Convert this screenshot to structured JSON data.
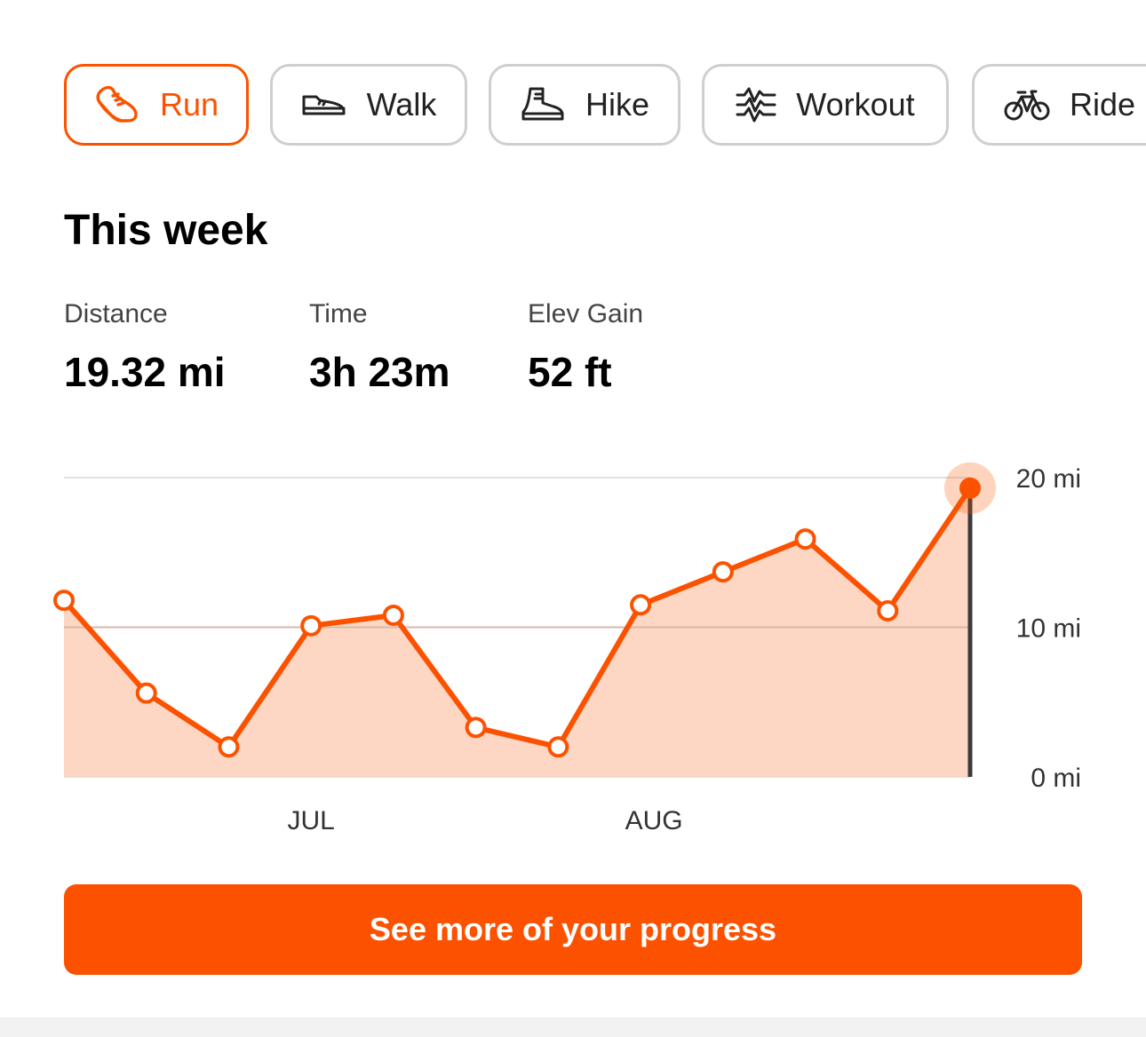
{
  "activity_tabs": [
    {
      "label": "Run",
      "icon": "shoe-run-icon",
      "active": true
    },
    {
      "label": "Walk",
      "icon": "shoe-walk-icon",
      "active": false
    },
    {
      "label": "Hike",
      "icon": "boot-hike-icon",
      "active": false
    },
    {
      "label": "Workout",
      "icon": "workout-wave-icon",
      "active": false
    },
    {
      "label": "Ride",
      "icon": "bicycle-icon",
      "active": false
    }
  ],
  "section_title": "This week",
  "stats": [
    {
      "label": "Distance",
      "value": "19.32 mi"
    },
    {
      "label": "Time",
      "value": "3h 23m"
    },
    {
      "label": "Elev Gain",
      "value": "52 ft"
    }
  ],
  "chart_data": {
    "type": "area",
    "x_labels": [
      "JUL",
      "AUG"
    ],
    "y_ticks": [
      "20 mi",
      "10 mi",
      "0 mi"
    ],
    "ylim": [
      0,
      20
    ],
    "grid": true,
    "series": [
      {
        "values": [
          11.8,
          5.6,
          2.0,
          10.1,
          10.8,
          3.3,
          2.0,
          11.5,
          13.7,
          15.9,
          11.1,
          19.3
        ]
      }
    ],
    "highlighted_point_index": 11
  },
  "colors": {
    "accent": "#fc5200",
    "fill": "#fdd3be",
    "grid": "#e1e1e1"
  },
  "cta_label": "See more of your progress"
}
